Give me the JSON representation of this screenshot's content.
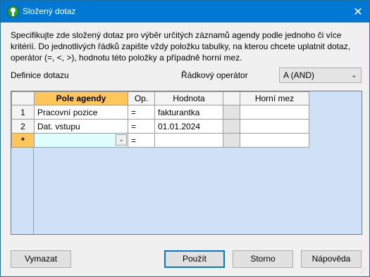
{
  "window": {
    "title": "Složený dotaz",
    "close_glyph": "✕"
  },
  "description": "Specifikujte zde složený dotaz pro výběr určitých záznamů agendy podle jednoho či více kritérií. Do jednotlivých řádků zapište vždy položku tabulky, na kterou chcete uplatnit dotaz, operátor (=, <, >), hodnotu této položky a případně horní mez.",
  "labels": {
    "query_definition": "Definice dotazu",
    "row_operator": "Řádkový operátor"
  },
  "row_operator_select": {
    "selected": "A (AND)",
    "chevron": "⌄"
  },
  "grid": {
    "columns": [
      "Pole agendy",
      "Op.",
      "Hodnota",
      "",
      "Horní mez"
    ],
    "rows": [
      {
        "num": "1",
        "field": "Pracovní pozice",
        "op": "=",
        "value": "fakturantka",
        "extra": "",
        "upper": ""
      },
      {
        "num": "2",
        "field": "Dat. vstupu",
        "op": "=",
        "value": "01.01.2024",
        "extra": "",
        "upper": ""
      }
    ],
    "new_row": {
      "num": "*",
      "field": "",
      "op": "=",
      "value": "",
      "extra": "",
      "upper": ""
    },
    "dropdown_glyph": "⌄"
  },
  "buttons": {
    "clear": "Vymazat",
    "apply": "Použít",
    "cancel": "Storno",
    "help": "Nápověda"
  },
  "colors": {
    "titlebar": "#0078d4",
    "grid_background": "#cfe1f6",
    "active_header": "#ffc65c",
    "edit_cell": "#e0fdfd"
  }
}
